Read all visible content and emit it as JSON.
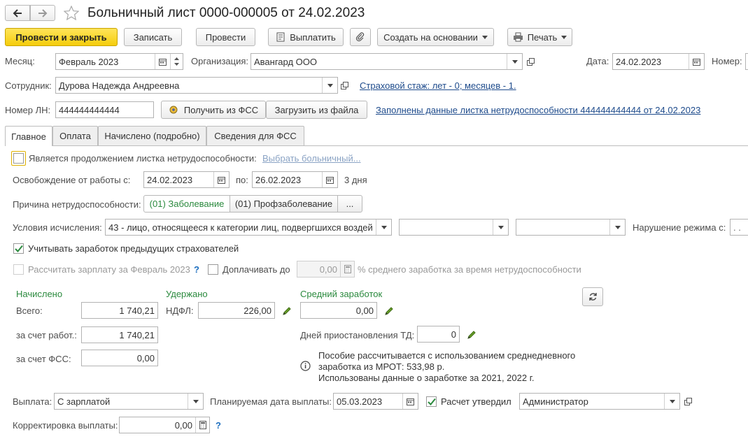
{
  "header": {
    "title": "Больничный лист 0000-000005 от 24.02.2023"
  },
  "toolbar": {
    "post_close": "Провести и закрыть",
    "save": "Записать",
    "post": "Провести",
    "pay": "Выплатить",
    "create_based": "Создать на основании",
    "print": "Печать"
  },
  "fields": {
    "month_label": "Месяц:",
    "month_value": "Февраль 2023",
    "org_label": "Организация:",
    "org_value": "Авангард ООО",
    "date_label": "Дата:",
    "date_value": "24.02.2023",
    "number_label": "Номер:",
    "employee_label": "Сотрудник:",
    "employee_value": "Дурова Надежда Андреевна",
    "insurance_link": "Страховой стаж: лет - 0; месяцев - 1.",
    "ln_label": "Номер ЛН:",
    "ln_value": "444444444444",
    "get_fss": "Получить из ФСС",
    "load_file": "Загрузить из файла",
    "filled_link": "Заполнены данные листка нетрудоспособности 444444444444 от 24.02.2023"
  },
  "tabs": [
    {
      "label": "Главное"
    },
    {
      "label": "Оплата"
    },
    {
      "label": "Начислено (подробно)"
    },
    {
      "label": "Сведения для ФСС"
    }
  ],
  "main": {
    "continuation_label": "Является продолжением листка нетрудоспособности:",
    "select_sick_link": "Выбрать больничный...",
    "release_label": "Освобождение от работы с:",
    "release_from": "24.02.2023",
    "release_to_label": "по:",
    "release_to": "26.02.2023",
    "days": "3 дня",
    "reason_label": "Причина нетрудоспособности:",
    "reason_options": [
      "(01) Заболевание",
      "(01) Профзаболевание",
      "..."
    ],
    "conditions_label": "Условия исчисления:",
    "conditions_value": "43 - лицо, относящееся к категории лиц, подвергшихся воздей",
    "violation_label": "Нарушение режима с:",
    "violation_value": ". .",
    "prev_insurers_label": "Учитывать заработок предыдущих страхователей",
    "prev_insurers_checked": true,
    "calc_salary_label": "Рассчитать зарплату за Февраль 2023",
    "calc_salary_help": "?",
    "topup_label": "Доплачивать до",
    "topup_value": "0,00",
    "topup_suffix": "% среднего заработка за время нетрудоспособности"
  },
  "accrued": {
    "header": "Начислено",
    "total_label": "Всего:",
    "total_value": "1 740,21",
    "employer_label": "за счет работ.:",
    "employer_value": "1 740,21",
    "fss_label": "за счет ФСС:",
    "fss_value": "0,00"
  },
  "withheld": {
    "header": "Удержано",
    "ndfl_label": "НДФЛ:",
    "ndfl_value": "226,00"
  },
  "average": {
    "header": "Средний заработок",
    "value": "0,00",
    "suspension_label": "Дней приостановления ТД:",
    "suspension_value": "0",
    "info_line1": "Пособие рассчитывается с использованием среднедневного",
    "info_line2": "заработка из МРОТ: 533,98 р.",
    "info_line3": "Использованы данные о заработке за  2021,  2022 г."
  },
  "footer": {
    "payout_label": "Выплата:",
    "payout_value": "С зарплатой",
    "planned_date_label": "Планируемая дата выплаты:",
    "planned_date_value": "05.03.2023",
    "approved_label": "Расчет утвердил",
    "approved_checked": true,
    "approver_value": "Администратор",
    "correction_label": "Корректировка выплаты:",
    "correction_value": "0,00",
    "correction_help": "?"
  },
  "colors": {
    "primary_button": "#f5cd0c",
    "link": "#1e4b8c",
    "section_header": "#2b8a3e",
    "help": "#1e6fbf"
  }
}
